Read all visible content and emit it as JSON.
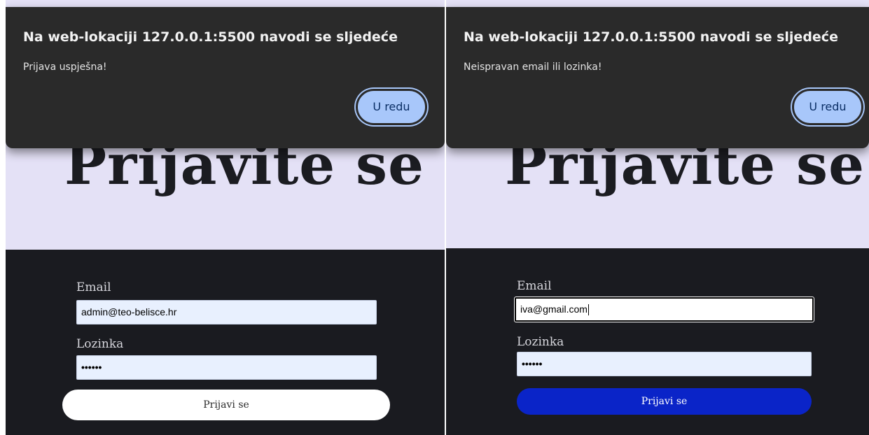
{
  "panels": [
    {
      "dialog": {
        "title": "Na web-lokaciji 127.0.0.1:5500 navodi se sljedeće",
        "message": "Prijava uspješna!",
        "ok_label": "U redu"
      },
      "hero_title": "Prijavite se",
      "form": {
        "email_label": "Email",
        "email_value": "admin@teo-belisce.hr",
        "password_label": "Lozinka",
        "password_value": "••••••",
        "submit_label": "Prijavi se"
      }
    },
    {
      "dialog": {
        "title": "Na web-lokaciji 127.0.0.1:5500 navodi se sljedeće",
        "message": "Neispravan email ili lozinka!",
        "ok_label": "U redu"
      },
      "hero_title": "Prijavite se",
      "form": {
        "email_label": "Email",
        "email_value": "iva@gmail.com",
        "password_label": "Lozinka",
        "password_value": "••••••",
        "submit_label": "Prijavi se"
      }
    }
  ],
  "colors": {
    "hero_bg": "#e4e1f6",
    "form_bg": "#1a1b20",
    "dialog_bg": "#2a2a2a",
    "ok_button": "#a8c7fa",
    "submit_white": "#ffffff",
    "submit_blue": "#0a24c8",
    "input_bg": "#e8f0fe"
  }
}
